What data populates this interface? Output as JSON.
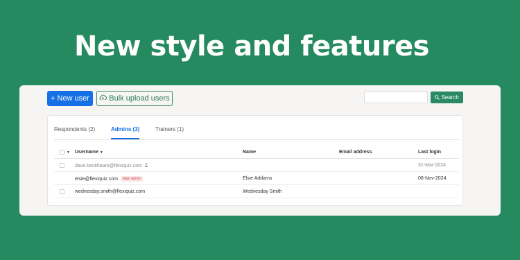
{
  "headline": "New style and features",
  "toolbar": {
    "new_user_label": "+ New user",
    "bulk_upload_label": "Bulk upload users",
    "search_placeholder": "",
    "search_label": "Search"
  },
  "tabs": [
    {
      "label": "Respondents (2)",
      "active": false
    },
    {
      "label": "Admins (3)",
      "active": true
    },
    {
      "label": "Trainers (1)",
      "active": false
    }
  ],
  "table": {
    "columns": [
      "Username",
      "Name",
      "Email address",
      "Last login"
    ],
    "rows": [
      {
        "username": "dave.beckhaam@flexiquiz.com",
        "name": "",
        "email": "",
        "last_login": "31-Mar-2024",
        "dim": true
      },
      {
        "username": "elsie@flexiquiz.com",
        "badge": "Main admin",
        "name": "Elsie Addams",
        "email": "",
        "last_login": "08-Nov-2024"
      },
      {
        "username": "wednesday.smith@flexiquiz.com",
        "name": "Wednesday Smith",
        "email": "",
        "last_login": ""
      }
    ]
  },
  "colors": {
    "background": "#258a5f",
    "primary": "#1570e6",
    "accent_green": "#2a8a66"
  }
}
